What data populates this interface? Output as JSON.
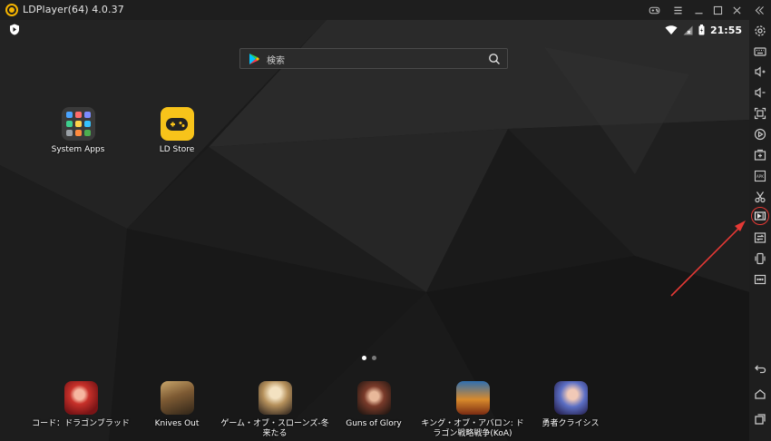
{
  "window": {
    "title": "LDPlayer(64) 4.0.37"
  },
  "status_bar": {
    "time": "21:55"
  },
  "search": {
    "placeholder": "検索"
  },
  "desktop_apps": [
    {
      "label": "System Apps"
    },
    {
      "label": "LD Store"
    }
  ],
  "dock_apps": [
    {
      "label": "コード：ドラゴンブラッド"
    },
    {
      "label": "Knives Out"
    },
    {
      "label": "ゲーム・オブ・スローンズ-冬来たる"
    },
    {
      "label": "Guns of Glory"
    },
    {
      "label": "キング・オブ・アバロン: ドラゴン戦略戦争(KoA)"
    },
    {
      "label": "勇者クライシス"
    }
  ],
  "page_indicator": {
    "current": 1,
    "total": 2
  },
  "colors": {
    "accent_yellow": "#f7c31a",
    "annotation_red": "#e53935",
    "sidebar_bg": "#1e1e1e"
  },
  "sidebar_tools": [
    {
      "icon": "settings-icon"
    },
    {
      "icon": "keyboard-icon"
    },
    {
      "icon": "volume-up-icon"
    },
    {
      "icon": "volume-down-icon"
    },
    {
      "icon": "fullscreen-icon"
    },
    {
      "icon": "macro-record-icon"
    },
    {
      "icon": "add-app-icon"
    },
    {
      "icon": "apk-install-icon"
    },
    {
      "icon": "screenshot-scissors-icon"
    },
    {
      "icon": "video-record-icon"
    },
    {
      "icon": "sync-windows-icon"
    },
    {
      "icon": "shake-icon"
    },
    {
      "icon": "more-icon"
    }
  ],
  "nav_tools": [
    {
      "icon": "back-icon"
    },
    {
      "icon": "home-icon"
    },
    {
      "icon": "recent-apps-icon"
    }
  ]
}
